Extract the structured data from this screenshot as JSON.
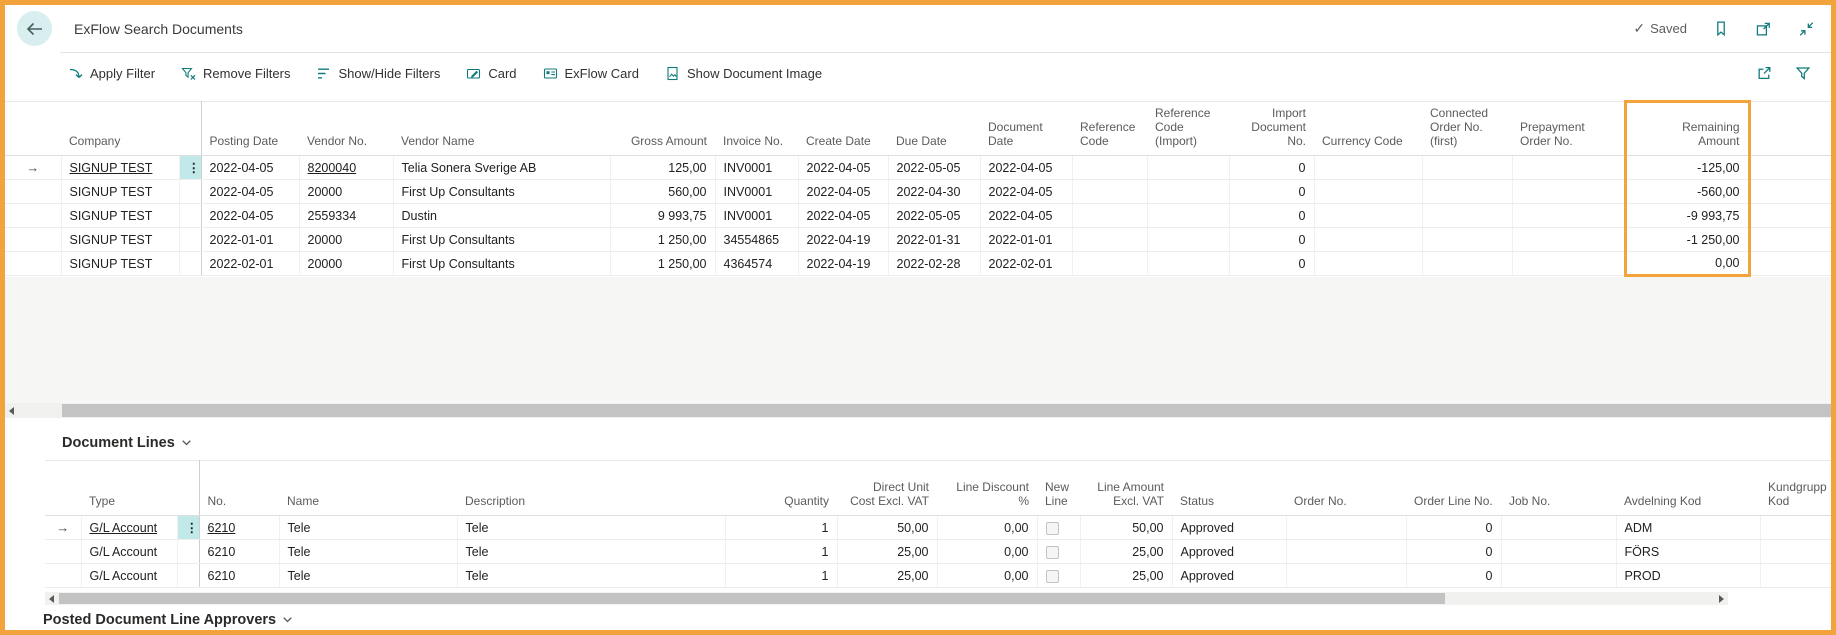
{
  "theme": {
    "accent": "#0f7b7c",
    "orange": "#f2a33c",
    "amount": "#17808c",
    "selection_tint": "#c2e9ea"
  },
  "header": {
    "title": "ExFlow Search Documents",
    "saved_label": "Saved"
  },
  "toolbar": {
    "apply_filter": "Apply Filter",
    "remove_filters": "Remove Filters",
    "show_hide_filters": "Show/Hide Filters",
    "card": "Card",
    "exflow_card": "ExFlow Card",
    "show_document_image": "Show Document Image"
  },
  "documents_table": {
    "highlighted_column": "Remaining Amount",
    "columns": [
      "Company",
      "Posting Date",
      "Vendor No.",
      "Vendor Name",
      "Gross Amount",
      "Invoice No.",
      "Create Date",
      "Due Date",
      "Document Date",
      "Reference Code",
      "Reference Code (Import)",
      "Import Document No.",
      "Currency Code",
      "Connected Order No. (first)",
      "Prepayment Order No.",
      "Remaining Amount"
    ],
    "rows": [
      {
        "company": "SIGNUP TEST",
        "posting_date": "2022-04-05",
        "vendor_no": "8200040",
        "vendor_name": "Telia Sonera Sverige AB",
        "gross_amount": "125,00",
        "invoice_no": "INV0001",
        "create_date": "2022-04-05",
        "due_date": "2022-05-05",
        "document_date": "2022-04-05",
        "import_document_no": "0",
        "remaining_amount": "-125,00",
        "menu_icon": "⋮"
      },
      {
        "company": "SIGNUP TEST",
        "posting_date": "2022-04-05",
        "vendor_no": "20000",
        "vendor_name": "First Up Consultants",
        "gross_amount": "560,00",
        "invoice_no": "INV0001",
        "create_date": "2022-04-05",
        "due_date": "2022-04-30",
        "document_date": "2022-04-05",
        "import_document_no": "0",
        "remaining_amount": "-560,00"
      },
      {
        "company": "SIGNUP TEST",
        "posting_date": "2022-04-05",
        "vendor_no": "2559334",
        "vendor_name": "Dustin",
        "gross_amount": "9 993,75",
        "invoice_no": "INV0001",
        "create_date": "2022-04-05",
        "due_date": "2022-05-05",
        "document_date": "2022-04-05",
        "import_document_no": "0",
        "remaining_amount": "-9 993,75"
      },
      {
        "company": "SIGNUP TEST",
        "posting_date": "2022-01-01",
        "vendor_no": "20000",
        "vendor_name": "First Up Consultants",
        "gross_amount": "1 250,00",
        "invoice_no": "34554865",
        "create_date": "2022-04-19",
        "due_date": "2022-01-31",
        "document_date": "2022-01-01",
        "import_document_no": "0",
        "remaining_amount": "-1 250,00"
      },
      {
        "company": "SIGNUP TEST",
        "posting_date": "2022-02-01",
        "vendor_no": "20000",
        "vendor_name": "First Up Consultants",
        "gross_amount": "1 250,00",
        "invoice_no": "4364574",
        "create_date": "2022-04-19",
        "due_date": "2022-02-28",
        "document_date": "2022-02-01",
        "import_document_no": "0",
        "remaining_amount": "0,00"
      }
    ]
  },
  "document_lines": {
    "section_title": "Document Lines",
    "columns": [
      "Type",
      "No.",
      "Name",
      "Description",
      "Quantity",
      "Direct Unit Cost Excl. VAT",
      "Line Discount %",
      "New Line",
      "Line Amount Excl. VAT",
      "Status",
      "Order No.",
      "Order Line No.",
      "Job No.",
      "Avdelning Kod",
      "Kundgrupp Kod"
    ],
    "rows": [
      {
        "type": "G/L Account",
        "no": "6210",
        "name": "Tele",
        "description": "Tele",
        "quantity": "1",
        "direct_unit_cost": "50,00",
        "line_discount": "0,00",
        "new_line": false,
        "line_amount": "50,00",
        "status": "Approved",
        "order_line_no": "0",
        "avdelning_kod": "ADM",
        "menu_icon": "⋮"
      },
      {
        "type": "G/L Account",
        "no": "6210",
        "name": "Tele",
        "description": "Tele",
        "quantity": "1",
        "direct_unit_cost": "25,00",
        "line_discount": "0,00",
        "new_line": false,
        "line_amount": "25,00",
        "status": "Approved",
        "order_line_no": "0",
        "avdelning_kod": "FÖRS"
      },
      {
        "type": "G/L Account",
        "no": "6210",
        "name": "Tele",
        "description": "Tele",
        "quantity": "1",
        "direct_unit_cost": "25,00",
        "line_discount": "0,00",
        "new_line": false,
        "line_amount": "25,00",
        "status": "Approved",
        "order_line_no": "0",
        "avdelning_kod": "PROD"
      }
    ]
  },
  "posted_section": {
    "title": "Posted Document Line Approvers"
  },
  "misc": {
    "selected_row_arrow": "→",
    "saved_check": "✓"
  }
}
